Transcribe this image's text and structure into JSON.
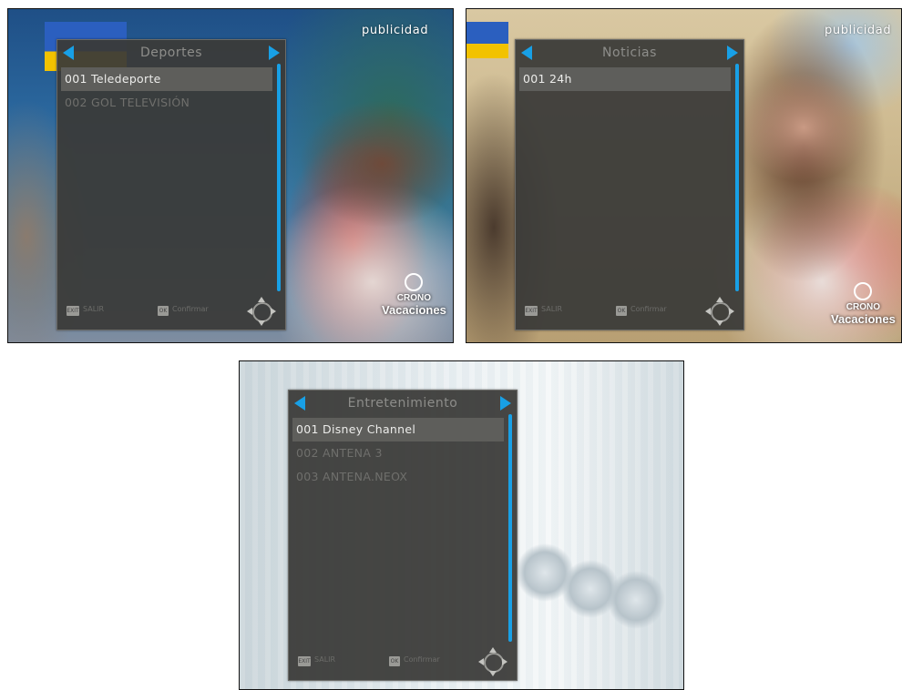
{
  "screens": [
    {
      "category": "Deportes",
      "overlay_text": "publicidad",
      "logo": {
        "line1": "CRONO",
        "line2": "Vacaciones"
      },
      "channels": [
        {
          "label": "001 Teledeporte",
          "selected": true
        },
        {
          "label": "002 GOL TELEVISIÓN",
          "selected": false
        }
      ],
      "footer": {
        "exit_key": "EXIT",
        "exit_label": "SALIR",
        "ok_key": "OK",
        "ok_label": "Confirmar"
      }
    },
    {
      "category": "Noticias",
      "overlay_text": "publicidad",
      "logo": {
        "line1": "CRONO",
        "line2": "Vacaciones"
      },
      "channels": [
        {
          "label": "001 24h",
          "selected": true
        }
      ],
      "footer": {
        "exit_key": "EXIT",
        "exit_label": "SALIR",
        "ok_key": "OK",
        "ok_label": "Confirmar"
      }
    },
    {
      "category": "Entretenimiento",
      "channels": [
        {
          "label": "001 Disney Channel",
          "selected": true
        },
        {
          "label": "002 ANTENA 3",
          "selected": false
        },
        {
          "label": "003 ANTENA.NEOX",
          "selected": false
        }
      ],
      "footer": {
        "exit_key": "EXIT",
        "exit_label": "SALIR",
        "ok_key": "OK",
        "ok_label": "Confirmar"
      }
    }
  ],
  "colors": {
    "accent": "#18a0e6",
    "panel_bg": "#3a3a38",
    "selected_row": "#5e5e5b",
    "selected_text": "#ececea",
    "inactive_text": "#6f6f6c"
  }
}
